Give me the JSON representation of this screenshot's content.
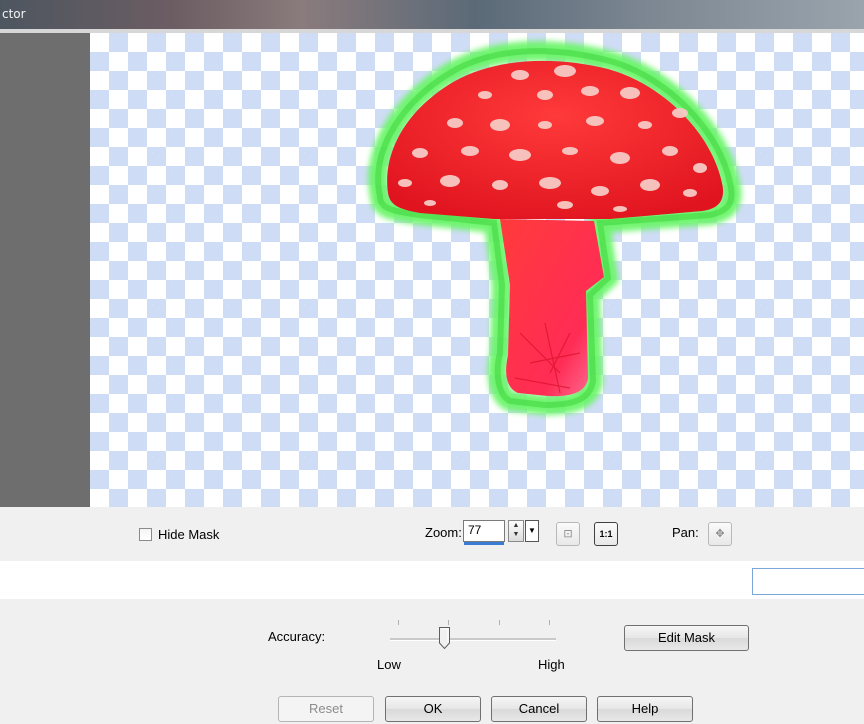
{
  "window": {
    "title_fragment": "ctor"
  },
  "canvas": {
    "checker_color": "#cfdcf5",
    "mask_outline_color": "#5ef05a",
    "subject_fill_color": "#f02a2a"
  },
  "controls": {
    "hide_mask_label": "Hide Mask",
    "hide_mask_checked": false,
    "zoom_label": "Zoom:",
    "zoom_value": "77",
    "zoom_fit_icon": "fit-window-icon",
    "zoom_actual_label": "1:1",
    "pan_label": "Pan:",
    "pan_icon": "move-icon"
  },
  "bottom": {
    "accuracy_label": "Accuracy:",
    "accuracy_level_fraction": 0.33,
    "low_label": "Low",
    "high_label": "High",
    "edit_mask_label": "Edit Mask",
    "reset_label": "Reset",
    "ok_label": "OK",
    "cancel_label": "Cancel",
    "help_label": "Help"
  }
}
